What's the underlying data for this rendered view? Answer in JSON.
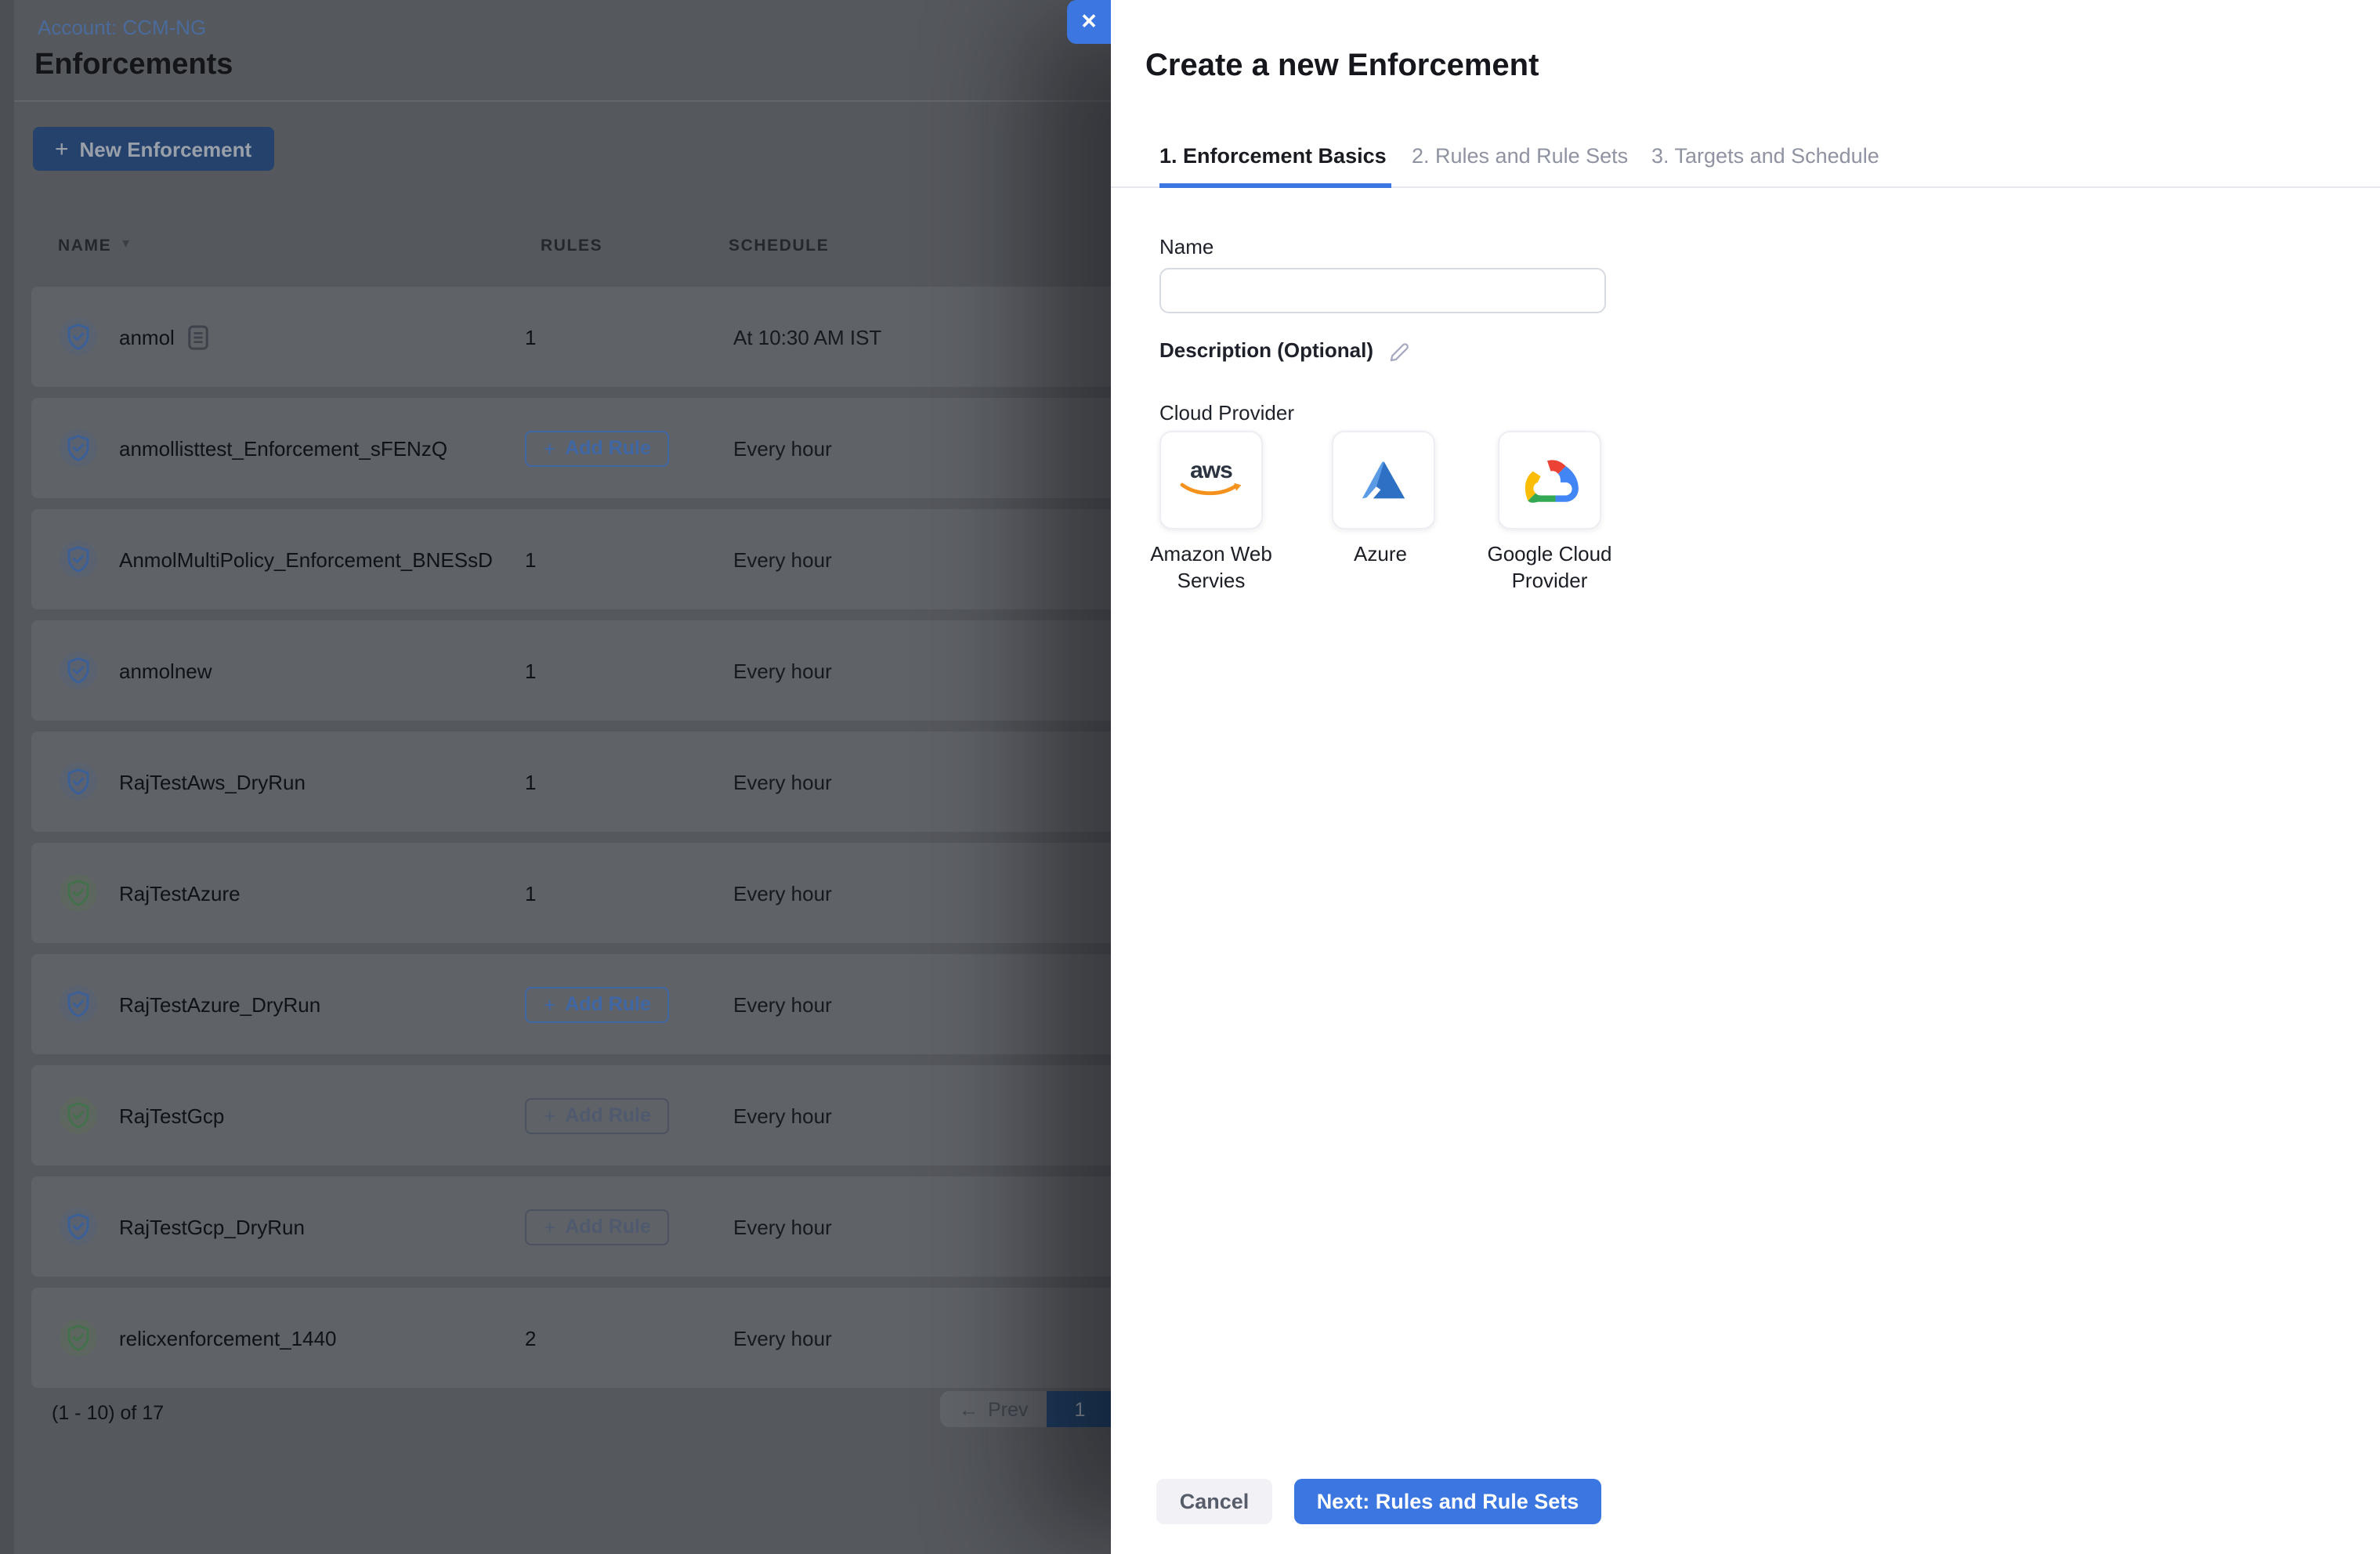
{
  "icons": {
    "close": "✕",
    "plus": "+",
    "sort_caret": "▾",
    "prev_arrow": "←"
  },
  "colors": {
    "accent_blue": "#3b76e1",
    "dim_overlay_bg": "#55585d",
    "active_page_navy": "#1e3f66",
    "shield_blue": "#3a5f99",
    "shield_green": "#43714c",
    "aws_orange": "#f5921e",
    "azure_blue": "#2e70c4",
    "gcp_red": "#ea4335",
    "gcp_blue": "#4285f4",
    "gcp_green": "#34a853",
    "gcp_yellow": "#fbbc05"
  },
  "page": {
    "breadcrumb": "Account: CCM-NG",
    "title": "Enforcements",
    "new_button_label": "New Enforcement",
    "table": {
      "columns": [
        "NAME",
        "RULES",
        "SCHEDULE"
      ],
      "add_rule_label": "Add Rule",
      "rows": [
        {
          "name": "anmol",
          "rules": "1",
          "schedule": "At 10:30 AM IST"
        },
        {
          "name": "anmollisttest_Enforcement_sFENzQ",
          "schedule": "Every hour"
        },
        {
          "name": "AnmolMultiPolicy_Enforcement_BNESsD",
          "rules": "1",
          "schedule": "Every hour"
        },
        {
          "name": "anmolnew",
          "rules": "1",
          "schedule": "Every hour"
        },
        {
          "name": "RajTestAws_DryRun",
          "rules": "1",
          "schedule": "Every hour"
        },
        {
          "name": "RajTestAzure",
          "rules": "1",
          "schedule": "Every hour"
        },
        {
          "name": "RajTestAzure_DryRun",
          "schedule": "Every hour"
        },
        {
          "name": "RajTestGcp",
          "schedule": "Every hour"
        },
        {
          "name": "RajTestGcp_DryRun",
          "schedule": "Every hour"
        },
        {
          "name": "relicxenforcement_1440",
          "rules": "2",
          "schedule": "Every hour"
        }
      ]
    },
    "pagination": {
      "range": "(1 - 10) of 17",
      "prev": "Prev",
      "current_page": "1"
    }
  },
  "drawer": {
    "title": "Create a new Enforcement",
    "tabs": [
      {
        "label": "1. Enforcement Basics"
      },
      {
        "label": "2. Rules and Rule Sets"
      },
      {
        "label": "3. Targets and Schedule"
      }
    ],
    "form": {
      "name_label": "Name",
      "name_value": "",
      "description_label": "Description (Optional)",
      "cloud_provider_label": "Cloud Provider",
      "providers": [
        {
          "label": "Amazon Web Servies",
          "logo_text": "aws"
        },
        {
          "label": "Azure"
        },
        {
          "label": "Google Cloud Provider"
        }
      ]
    },
    "footer": {
      "cancel_label": "Cancel",
      "next_label": "Next: Rules and Rule Sets"
    }
  }
}
